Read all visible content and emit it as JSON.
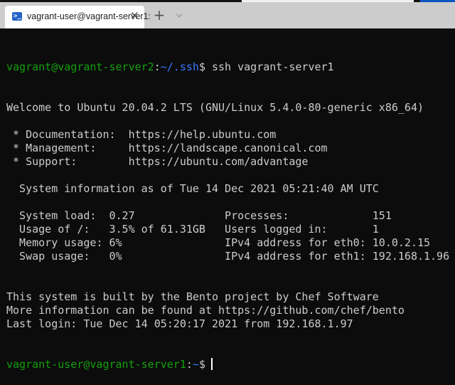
{
  "tab": {
    "title": "vagrant-user@vagrant-server1:",
    "icon": "powershell-icon"
  },
  "colors": {
    "prompt_green": "#13a10e",
    "path_blue": "#3b78ff",
    "text": "#cccccc",
    "background": "#0c0c0c"
  },
  "prompt1": {
    "user_host": "vagrant@vagrant-server2",
    "colon": ":",
    "path": "~/.ssh",
    "dollar": "$",
    "command": " ssh vagrant-server1"
  },
  "lines": [
    "Welcome to Ubuntu 20.04.2 LTS (GNU/Linux 5.4.0-80-generic x86_64)",
    "",
    " * Documentation:  https://help.ubuntu.com",
    " * Management:     https://landscape.canonical.com",
    " * Support:        https://ubuntu.com/advantage",
    "",
    "  System information as of Tue 14 Dec 2021 05:21:40 AM UTC",
    "",
    "  System load:  0.27              Processes:             151",
    "  Usage of /:   3.5% of 61.31GB   Users logged in:       1",
    "  Memory usage: 6%                IPv4 address for eth0: 10.0.2.15",
    "  Swap usage:   0%                IPv4 address for eth1: 192.168.1.96",
    "",
    "",
    "This system is built by the Bento project by Chef Software",
    "More information can be found at https://github.com/chef/bento",
    "Last login: Tue Dec 14 05:20:17 2021 from 192.168.1.97"
  ],
  "prompt2": {
    "user_host": "vagrant-user@vagrant-server1",
    "colon": ":",
    "path": "~",
    "dollar": "$"
  }
}
